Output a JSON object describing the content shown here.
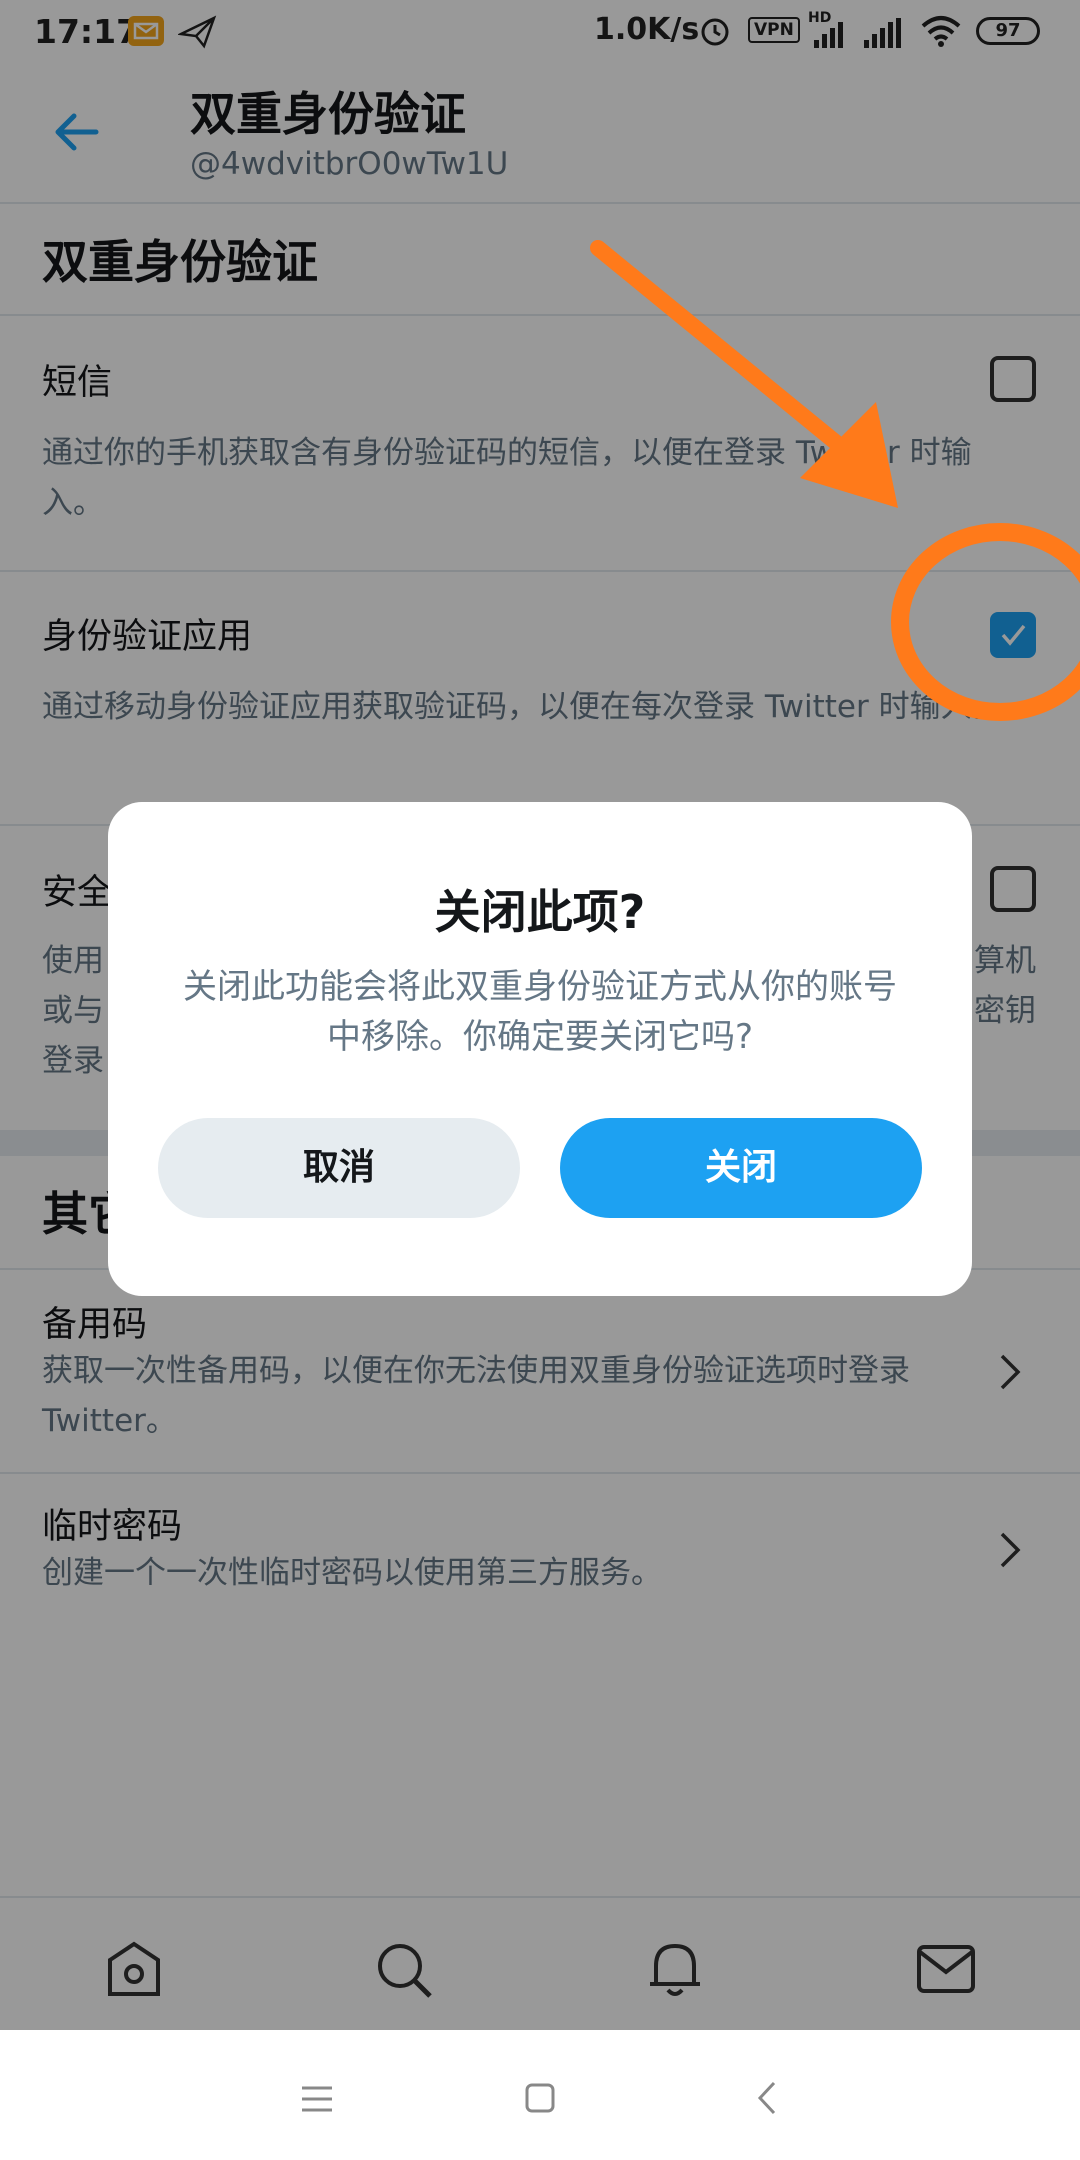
{
  "status_bar": {
    "time": "17:17",
    "speed": "1.0K/s",
    "vpn": "VPN",
    "hd": "HD",
    "battery": "97"
  },
  "header": {
    "title": "双重身份验证",
    "username": "@4wdvitbrO0wTw1U"
  },
  "section_title": "双重身份验证",
  "options": [
    {
      "title": "短信",
      "description": "通过你的手机获取含有身份验证码的短信，以便在登录 Twitter 时输入。",
      "checked": false
    },
    {
      "title": "身份验证应用",
      "description": "通过移动身份验证应用获取验证码，以便在每次登录 Twitter 时输入。",
      "checked": true
    },
    {
      "title": "安全",
      "description_lines": [
        "使用",
        "或与",
        "登录"
      ],
      "desc_right_lines": [
        "算机",
        "密钥"
      ],
      "checked": false
    }
  ],
  "other_section": {
    "title_partial": "其它",
    "items": [
      {
        "title": "备用码",
        "description": "获取一次性备用码，以便在你无法使用双重身份验证选项时登录 Twitter。"
      },
      {
        "title": "临时密码",
        "description": "创建一个一次性临时密码以使用第三方服务。"
      }
    ]
  },
  "dialog": {
    "title": "关闭此项?",
    "body": "关闭此功能会将此双重身份验证方式从你的账号中移除。你确定要关闭它吗?",
    "cancel_label": "取消",
    "confirm_label": "关闭"
  },
  "tab_bar": {
    "icons": [
      "home-icon",
      "search-icon",
      "notifications-icon",
      "messages-icon"
    ]
  },
  "colors": {
    "accent": "#1da1f2",
    "annotation": "#ff7a1a",
    "secondary_text": "#657786"
  }
}
